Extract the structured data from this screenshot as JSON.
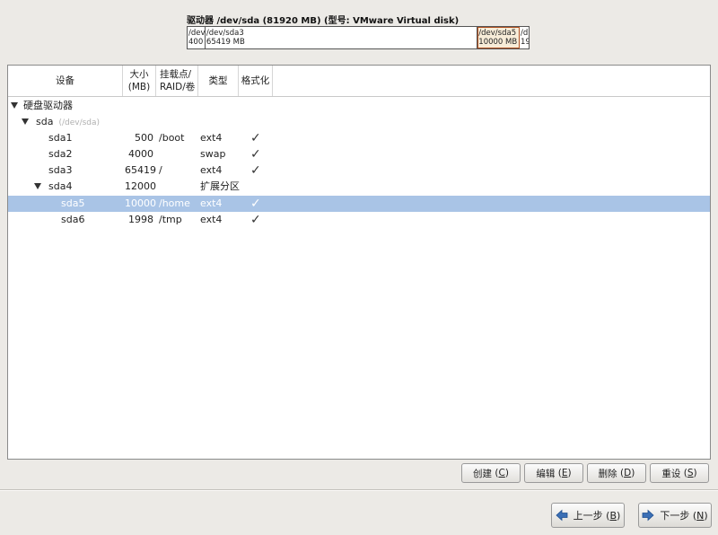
{
  "disk": {
    "title": "驱动器 /dev/sda (81920 MB) (型号: VMware Virtual disk)",
    "segments": [
      {
        "name": "/dev",
        "size": "400"
      },
      {
        "name": "/dev/sda3",
        "size": "65419 MB"
      },
      {
        "name": "/dev/sda5",
        "size": "10000 MB"
      },
      {
        "name": "/d",
        "size": "19"
      }
    ]
  },
  "table": {
    "headers": {
      "device": "设备",
      "size_line1": "大小",
      "size_line2": "(MB)",
      "mount_line1": "挂载点/",
      "mount_line2": "RAID/卷",
      "type": "类型",
      "format": "格式化"
    },
    "group": "硬盘驱动器",
    "disk": {
      "name": "sda",
      "path": "(/dev/sda)"
    },
    "rows": [
      {
        "device": "sda1",
        "size": "500",
        "mount": "/boot",
        "type": "ext4",
        "format": "✓"
      },
      {
        "device": "sda2",
        "size": "4000",
        "mount": "",
        "type": "swap",
        "format": "✓"
      },
      {
        "device": "sda3",
        "size": "65419",
        "mount": "/",
        "type": "ext4",
        "format": "✓"
      },
      {
        "device": "sda4",
        "size": "12000",
        "mount": "",
        "type": "扩展分区",
        "format": ""
      },
      {
        "device": "sda5",
        "size": "10000",
        "mount": "/home",
        "type": "ext4",
        "format": "✓"
      },
      {
        "device": "sda6",
        "size": "1998",
        "mount": "/tmp",
        "type": "ext4",
        "format": "✓"
      }
    ]
  },
  "actions": {
    "create": "创建",
    "create_key": "C",
    "edit": "编辑",
    "edit_key": "E",
    "delete": "删除",
    "delete_key": "D",
    "reset": "重设",
    "reset_key": "S"
  },
  "nav": {
    "back": "上一步",
    "back_key": "B",
    "next": "下一步",
    "next_key": "N"
  },
  "colors": {
    "selection": "#a9c4e6",
    "window_bg": "#eceae6",
    "nav_arrow": "#3b6fb5"
  }
}
